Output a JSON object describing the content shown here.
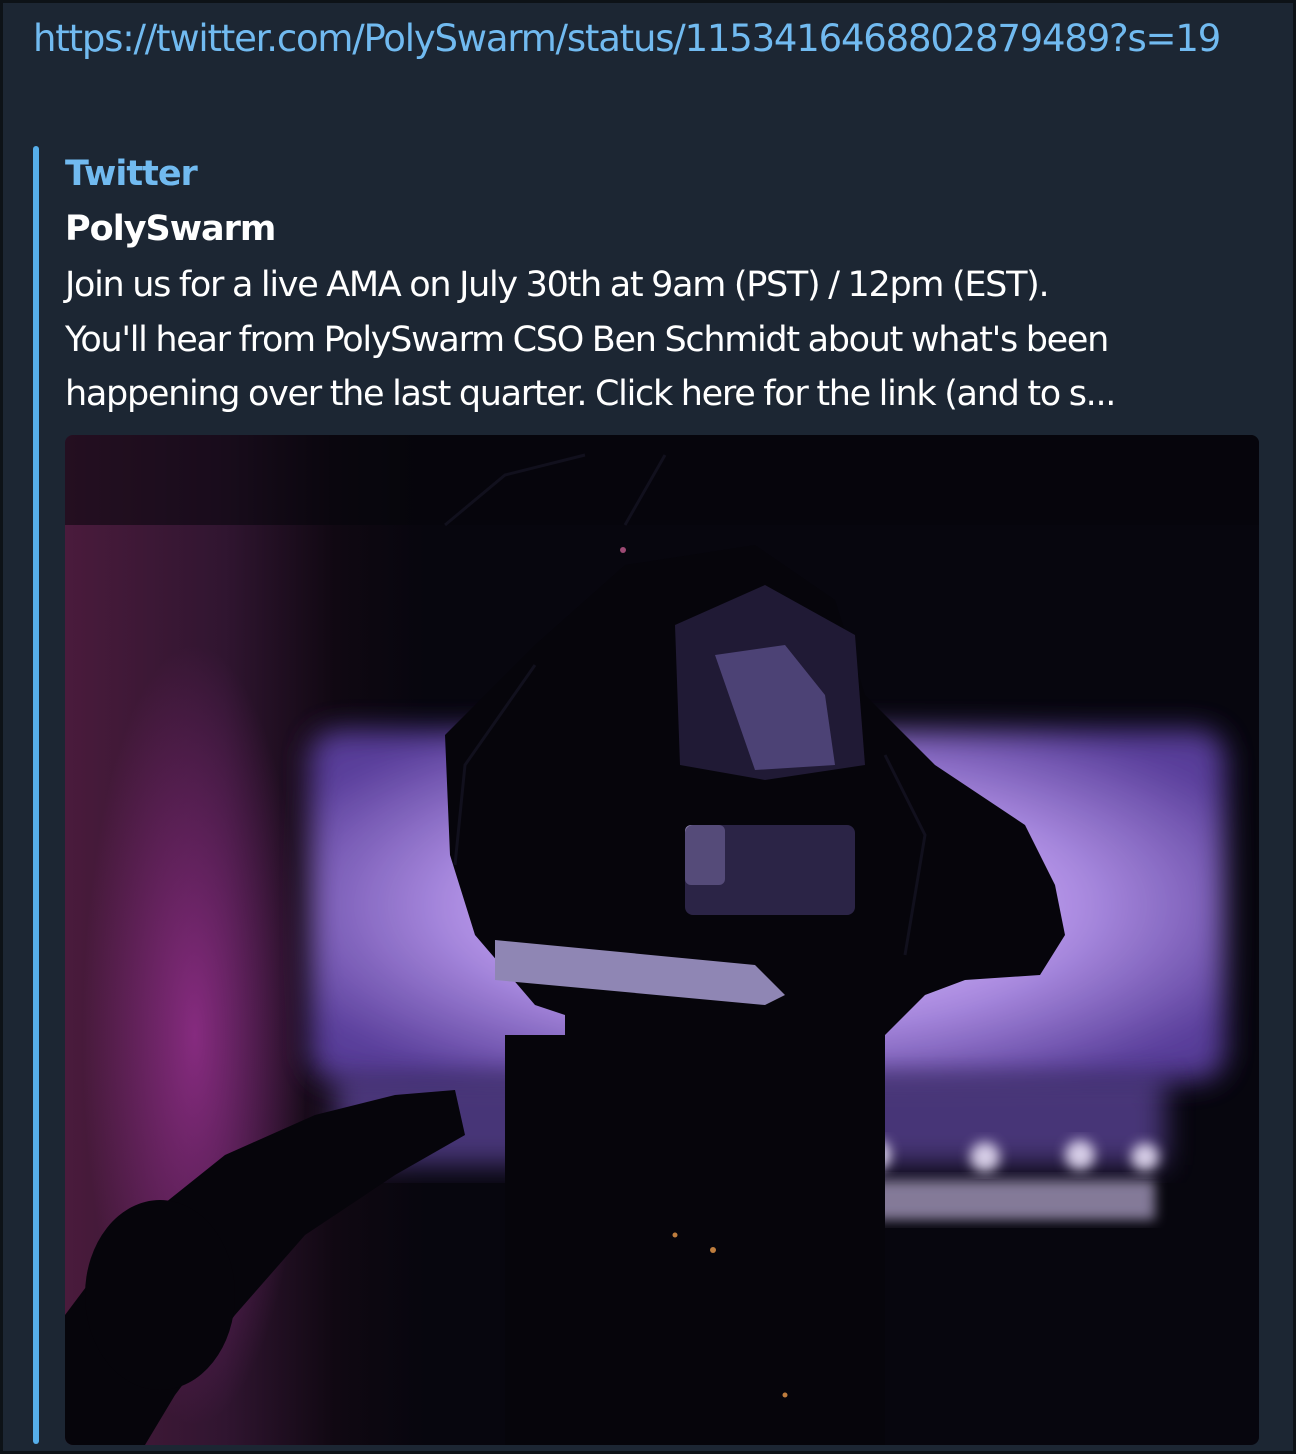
{
  "message": {
    "link_text": "https://twitter.com/PolySwarm/status/1153416468802879489?s=19"
  },
  "link_preview": {
    "site_name": "Twitter",
    "title": "PolySwarm",
    "description_lines": [
      "Join us for a live AMA on July 30th at 9am (PST) / 12pm (EST).",
      "You'll hear from PolySwarm CSO Ben Schmidt about what's been",
      "happening over the last quarter. Click here for the link (and to s..."
    ]
  },
  "colors": {
    "background": "#1c2633",
    "link": "#71baf0",
    "accent_bar": "#56aeea",
    "text": "#ffffff"
  }
}
